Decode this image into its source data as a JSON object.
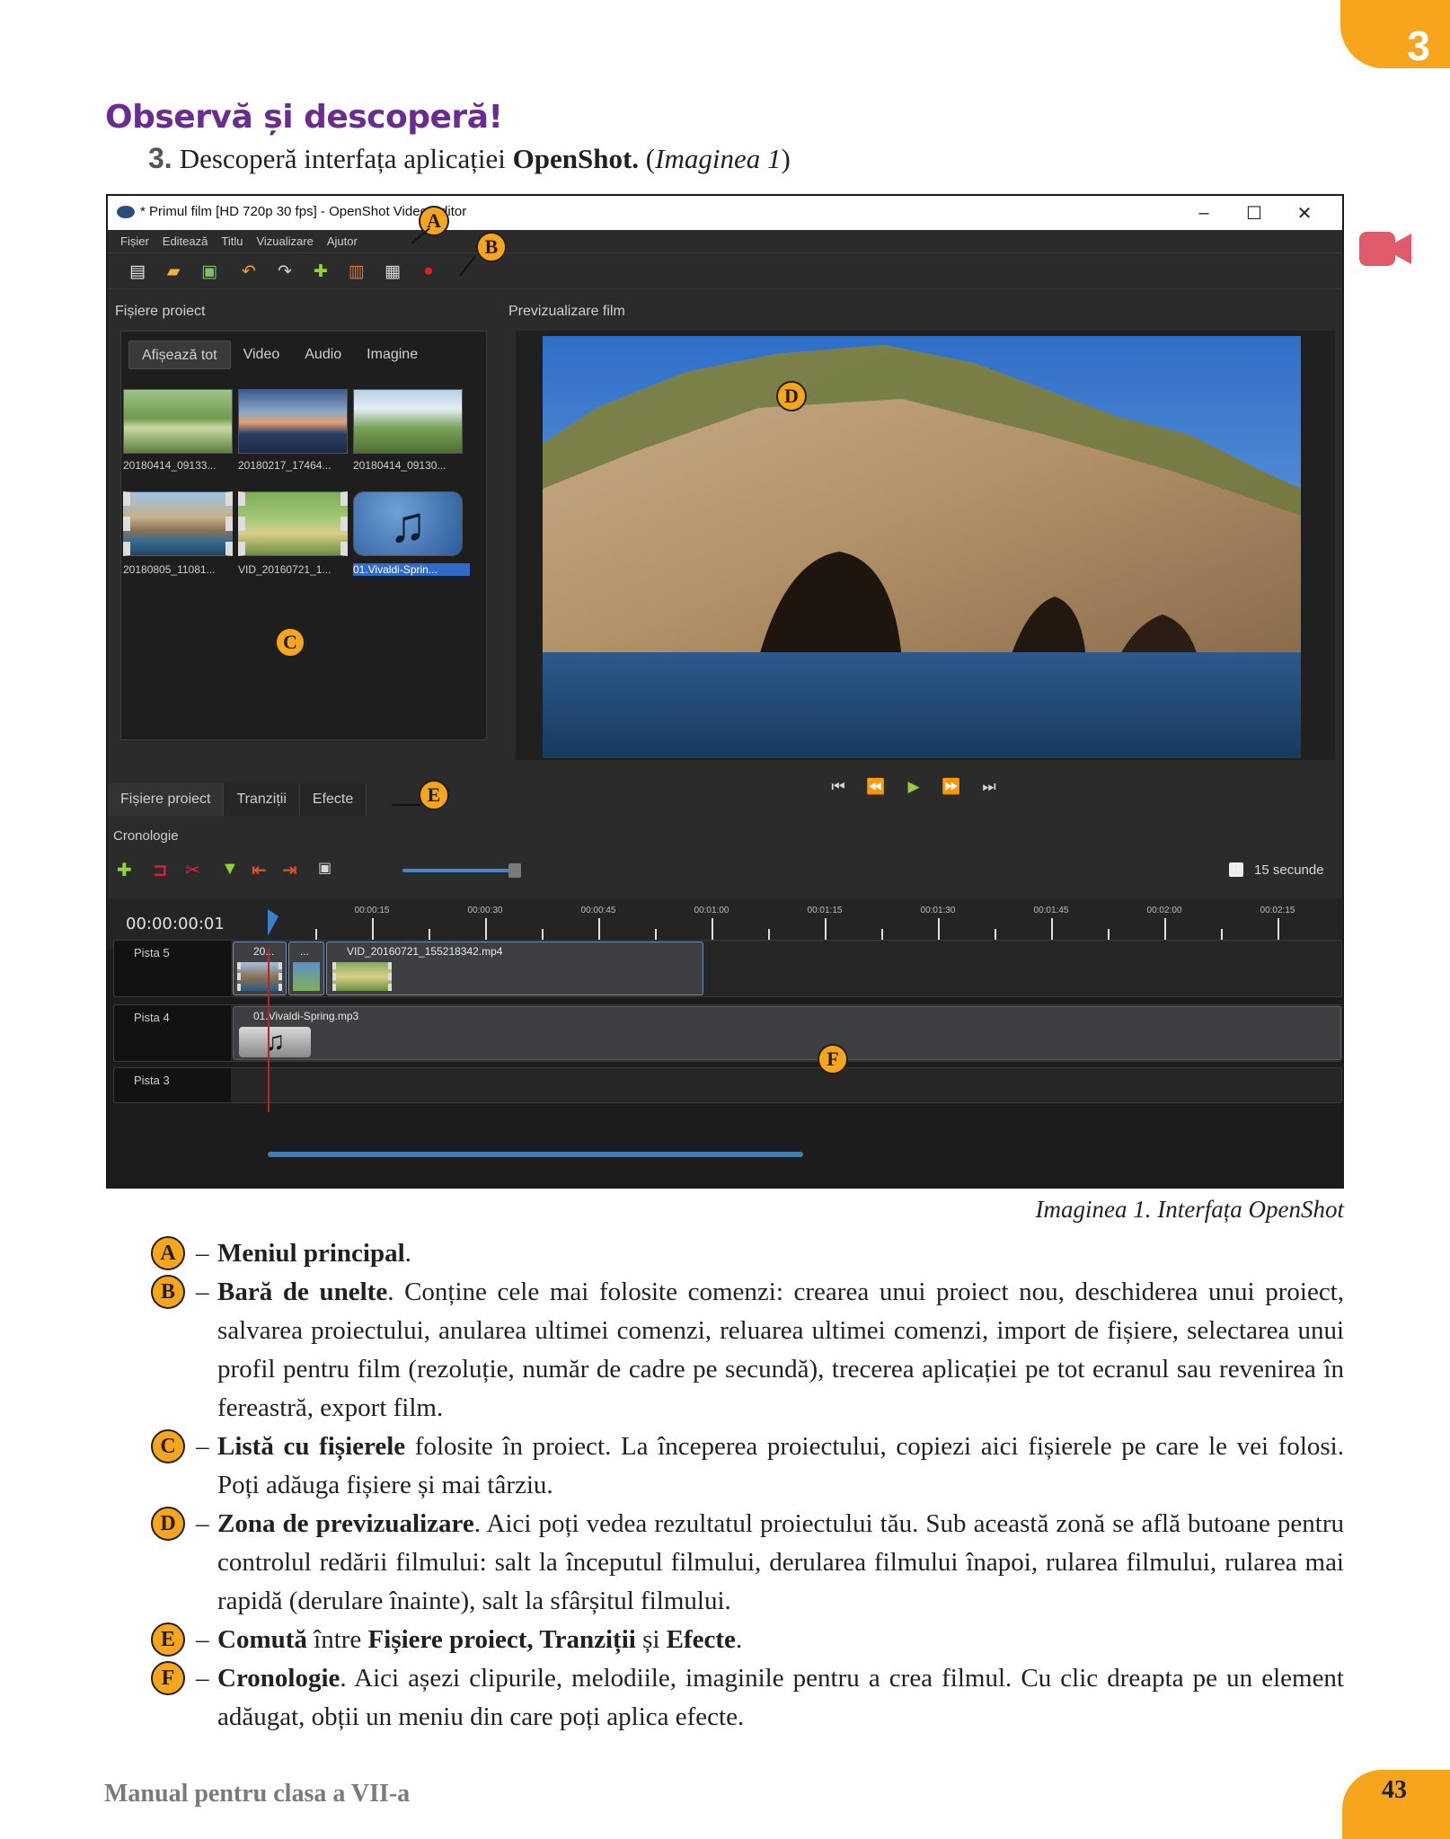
{
  "chapter": {
    "number": "3"
  },
  "section_title": "Observă și descoperă!",
  "exercise": {
    "number": "3.",
    "text_before": "Descoperă interfața aplicației ",
    "app_name": "OpenShot.",
    "paren_open": " (",
    "image_ref": "Imaginea 1",
    "paren_close": ")"
  },
  "screenshot": {
    "window_title": "* Primul film [HD 720p 30 fps] - OpenShot Video Editor",
    "window_controls": [
      "–",
      "☐",
      "✕"
    ],
    "menu": [
      "Fișier",
      "Editează",
      "Titlu",
      "Vizualizare",
      "Ajutor"
    ],
    "toolbar_icons": [
      "new-project-icon",
      "open-project-icon",
      "save-project-icon",
      "undo-icon",
      "redo-icon",
      "import-files-icon",
      "choose-profile-icon",
      "fullscreen-icon",
      "export-film-icon"
    ],
    "files_panel_title": "Fișiere proiect",
    "filter_tabs": [
      "Afișează tot",
      "Video",
      "Audio",
      "Imagine"
    ],
    "files": [
      {
        "label": "20180414_09133..."
      },
      {
        "label": "20180217_17464..."
      },
      {
        "label": "20180414_09130..."
      },
      {
        "label": "20180805_11081..."
      },
      {
        "label": "VID_20160721_1..."
      },
      {
        "label": "01.Vivaldi-Sprin..."
      }
    ],
    "preview_panel_title": "Previzualizare film",
    "playback_icons": [
      "jump-start-icon",
      "rewind-icon",
      "play-icon",
      "fast-forward-icon",
      "jump-end-icon"
    ],
    "bottom_tabs": [
      "Fișiere proiect",
      "Tranziții",
      "Efecte"
    ],
    "timeline_title": "Cronologie",
    "timeline_toolbar_icons": [
      "add-track-icon",
      "snapping-icon",
      "razor-icon",
      "add-marker-icon",
      "previous-marker-icon",
      "next-marker-icon",
      "center-timeline-icon"
    ],
    "zoom_label": "15 secunde",
    "timecode": "00:00:00:01",
    "ruler_labels": [
      "00:00:15",
      "00:00:30",
      "00:00:45",
      "00:01:00",
      "00:01:15",
      "00:01:30",
      "00:01:45",
      "00:02:00",
      "00:02:15"
    ],
    "tracks": [
      {
        "name": "Pista 5",
        "clips": [
          "20...",
          "...",
          "VID_20160721_155218342.mp4"
        ]
      },
      {
        "name": "Pista 4",
        "clips": [
          "01.Vivaldi-Spring.mp3"
        ]
      },
      {
        "name": "Pista 3",
        "clips": []
      }
    ],
    "callouts": [
      "A",
      "B",
      "C",
      "D",
      "E",
      "F"
    ]
  },
  "caption": "Imaginea 1. Interfața OpenShot",
  "descriptions": [
    {
      "marker": "A",
      "bold": "Meniul principal",
      "text": "."
    },
    {
      "marker": "B",
      "bold": "Bară de unelte",
      "text": ". Conține cele mai folosite comenzi: crearea unui proiect nou, deschiderea unui proiect, salvarea proiectului, anularea ultimei comenzi, reluarea ultimei comenzi, import de fișiere, selectarea unui profil pentru film (rezoluție, număr de cadre pe secundă), trecerea aplicației pe tot ecranul sau revenirea în fereastră, export film."
    },
    {
      "marker": "C",
      "bold": "Listă cu fișierele",
      "text": " folosite în proiect. La începerea proiectului, copiezi aici fișierele pe care le vei folosi. Poți adăuga fișiere și mai târziu."
    },
    {
      "marker": "D",
      "bold": "Zona de previzualizare",
      "text": ". Aici poți vedea rezultatul proiectului tău. Sub această zonă se află butoane pentru controlul redării filmului: salt la începutul filmului, derularea filmului înapoi, rularea filmului, rularea mai rapidă (derulare înainte), salt la sfârșitul filmului."
    },
    {
      "marker": "E",
      "bold": "Comută",
      "text": " între ",
      "bold2": "Fișiere proiect, Tranziții",
      "text2": " și ",
      "bold3": "Efecte",
      "text3": "."
    },
    {
      "marker": "F",
      "bold": "Cronologie",
      "text": ". Aici așezi clipurile, melodiile, imaginile pentru a crea filmul. Cu clic dreapta pe un element adăugat, obții un meniu din care poți aplica efecte."
    }
  ],
  "footer": {
    "book": "Manual pentru clasa a VII-a",
    "page": "43"
  },
  "colors": {
    "accent": "#f7a51c",
    "title": "#6a2c91",
    "video_icon": "#e05a6a"
  }
}
